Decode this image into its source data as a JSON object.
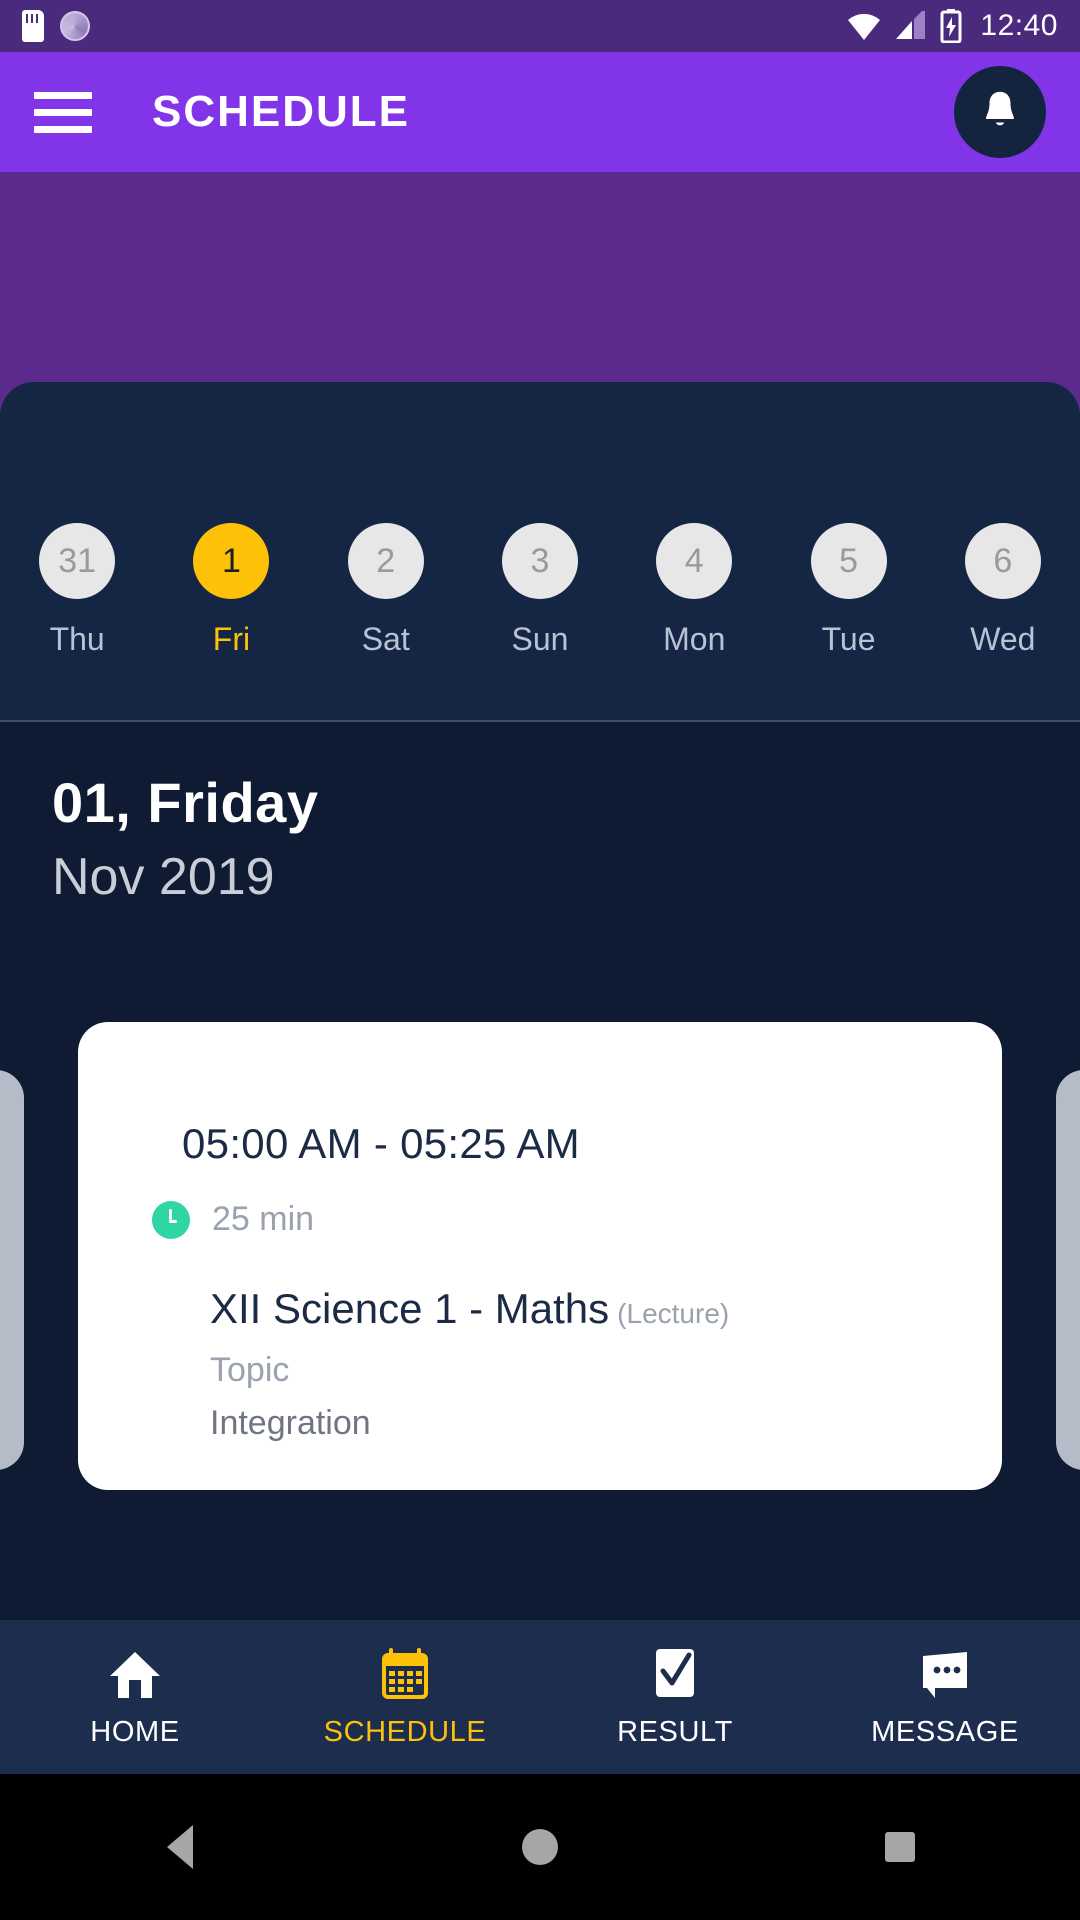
{
  "statusbar": {
    "time": "12:40",
    "icons": [
      "sdcard-icon",
      "spinner-icon",
      "wifi-icon",
      "signal-icon",
      "battery-charging-icon"
    ]
  },
  "appbar": {
    "menu_icon": "hamburger-menu-icon",
    "title": "SCHEDULE",
    "notification_icon": "bell-icon",
    "background_color": "#8234E9"
  },
  "date_strip": {
    "days": [
      {
        "date": "31",
        "day": "Thu",
        "active": false
      },
      {
        "date": "1",
        "day": "Fri",
        "active": true
      },
      {
        "date": "2",
        "day": "Sat",
        "active": false
      },
      {
        "date": "3",
        "day": "Sun",
        "active": false
      },
      {
        "date": "4",
        "day": "Mon",
        "active": false
      },
      {
        "date": "5",
        "day": "Tue",
        "active": false
      },
      {
        "date": "6",
        "day": "Wed",
        "active": false
      }
    ],
    "active_color": "#FDC108"
  },
  "date_heading": {
    "main": "01, Friday",
    "sub": "Nov 2019"
  },
  "lesson_card": {
    "time_range": "05:00 AM - 05:25 AM",
    "duration": "25 min",
    "duration_icon": "clock-icon",
    "duration_badge_color": "#2FD6A3",
    "subject": "XII Science 1 - Maths",
    "session_type": "(Lecture)",
    "topic_label": "Topic",
    "topic_value": "Integration"
  },
  "bottom_nav": {
    "items": [
      {
        "label": "HOME",
        "icon": "home-icon",
        "active": false
      },
      {
        "label": "SCHEDULE",
        "icon": "calendar-icon",
        "active": true
      },
      {
        "label": "RESULT",
        "icon": "checklist-icon",
        "active": false
      },
      {
        "label": "MESSAGE",
        "icon": "message-icon",
        "active": false
      }
    ],
    "active_color": "#FDC108"
  },
  "android_nav": {
    "back": "back-icon",
    "home": "home-circle-icon",
    "recents": "recents-icon"
  }
}
